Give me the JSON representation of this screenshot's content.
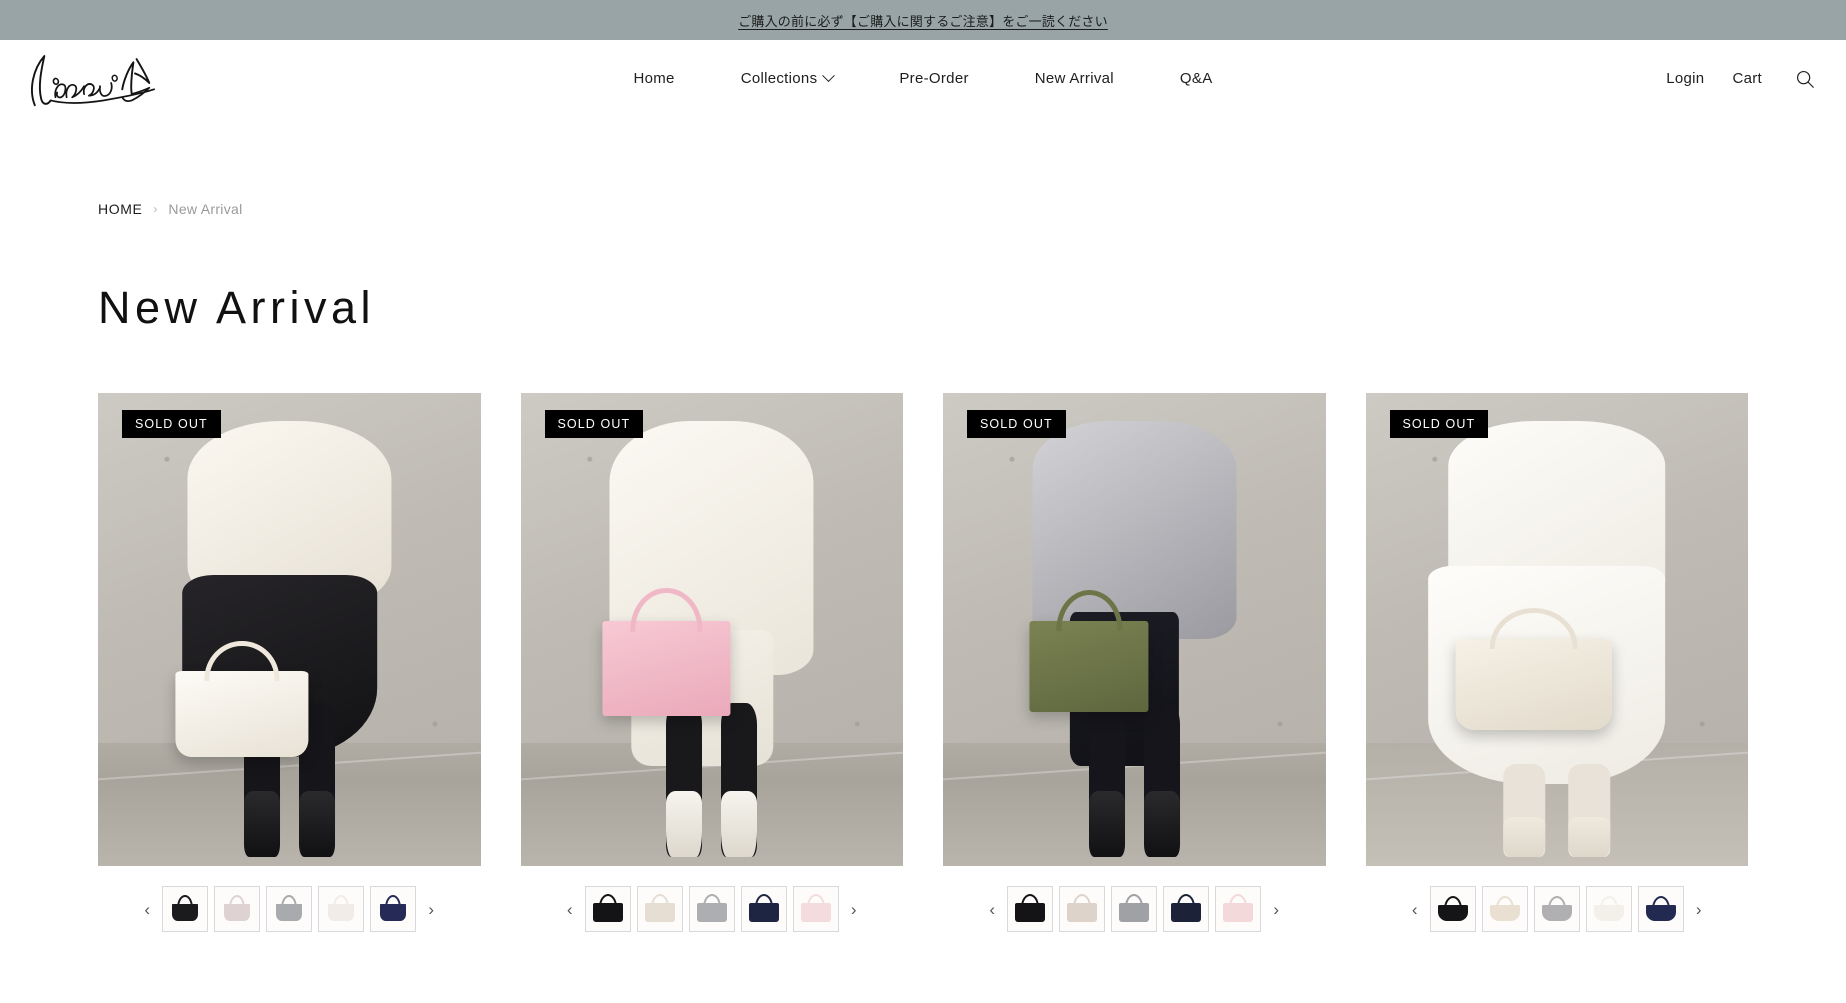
{
  "announcement": {
    "text": "ご購入の前に必ず【ご購入に関するご注意】をご一読ください"
  },
  "header": {
    "logo_alt": "handwritten-brand-signature",
    "nav": [
      {
        "label": "Home",
        "has_dropdown": false
      },
      {
        "label": "Collections",
        "has_dropdown": true
      },
      {
        "label": "Pre-Order",
        "has_dropdown": false
      },
      {
        "label": "New Arrival",
        "has_dropdown": false
      },
      {
        "label": "Q&A",
        "has_dropdown": false
      }
    ],
    "utils": [
      {
        "label": "Login"
      },
      {
        "label": "Cart"
      }
    ],
    "search_icon": "search-icon"
  },
  "breadcrumb": {
    "home": "HOME",
    "separator": "›",
    "current": "New Arrival"
  },
  "page": {
    "title": "New Arrival"
  },
  "colors": {
    "announcement_bg": "#98a4a6",
    "badge_bg": "#000000",
    "badge_text": "#ffffff",
    "text": "#1a1a1a",
    "muted_text": "#9a9a9a",
    "swatch_border": "#d9d9d9"
  },
  "products": [
    {
      "badge": "SOLD OUT",
      "scene": {
        "top_color": "#efece5",
        "bottom_color": "#232224",
        "bag_color": "#f4f1e9",
        "bag_style": "bucket-tote",
        "description": "model in cream puffer jacket and black skirt holding a white tote bag"
      },
      "prev_label": "‹",
      "next_label": "›",
      "swatches": [
        {
          "name": "black",
          "color": "#1b1b1d",
          "shape": "tote"
        },
        {
          "name": "pink-beige",
          "color": "#ded3d2",
          "shape": "tote"
        },
        {
          "name": "grey",
          "color": "#a8aaae",
          "shape": "tote"
        },
        {
          "name": "ivory",
          "color": "#f2ece8",
          "shape": "tote"
        },
        {
          "name": "navy",
          "color": "#262a57",
          "shape": "tote"
        }
      ]
    },
    {
      "badge": "SOLD OUT",
      "scene": {
        "top_color": "#f3f0e8",
        "bottom_color": "#1d1d1f",
        "bag_color": "#f0b8c6",
        "bag_style": "flat-tote",
        "description": "model in long white coat holding a pink flat tote bag"
      },
      "prev_label": "‹",
      "next_label": "›",
      "swatches": [
        {
          "name": "black",
          "color": "#141416",
          "shape": "flat"
        },
        {
          "name": "beige",
          "color": "#e6ddd3",
          "shape": "flat"
        },
        {
          "name": "grey",
          "color": "#adaeb2",
          "shape": "flat"
        },
        {
          "name": "navy",
          "color": "#1e2542",
          "shape": "flat"
        },
        {
          "name": "pink",
          "color": "#f4dbdd",
          "shape": "flat"
        }
      ]
    },
    {
      "badge": "SOLD OUT",
      "scene": {
        "top_color": "#c9c9cd",
        "bottom_color": "#1a1a22",
        "bag_color": "#6d7548",
        "bag_style": "flat-tote",
        "description": "model in grey knit and black vest holding an olive green flat tote bag"
      },
      "prev_label": "‹",
      "next_label": "›",
      "swatches": [
        {
          "name": "black",
          "color": "#141416",
          "shape": "flat"
        },
        {
          "name": "beige",
          "color": "#ded3ca",
          "shape": "flat"
        },
        {
          "name": "grey",
          "color": "#9fa1a5",
          "shape": "flat"
        },
        {
          "name": "navy",
          "color": "#1c2338",
          "shape": "flat"
        },
        {
          "name": "pink",
          "color": "#f3d9d9",
          "shape": "flat"
        }
      ]
    },
    {
      "badge": "SOLD OUT",
      "scene": {
        "top_color": "#f6f4ef",
        "bottom_color": "#f7f6f2",
        "bag_color": "#efe8dc",
        "bag_style": "wide-tote",
        "description": "model in white top and long white skirt holding a cream wide tote bag"
      },
      "prev_label": "‹",
      "next_label": "›",
      "swatches": [
        {
          "name": "black",
          "color": "#151517",
          "shape": "wide"
        },
        {
          "name": "beige",
          "color": "#e9e0d1",
          "shape": "wide"
        },
        {
          "name": "grey",
          "color": "#b0b0b2",
          "shape": "wide"
        },
        {
          "name": "ivory",
          "color": "#f3efe9",
          "shape": "wide"
        },
        {
          "name": "navy",
          "color": "#232a52",
          "shape": "wide"
        }
      ]
    }
  ]
}
